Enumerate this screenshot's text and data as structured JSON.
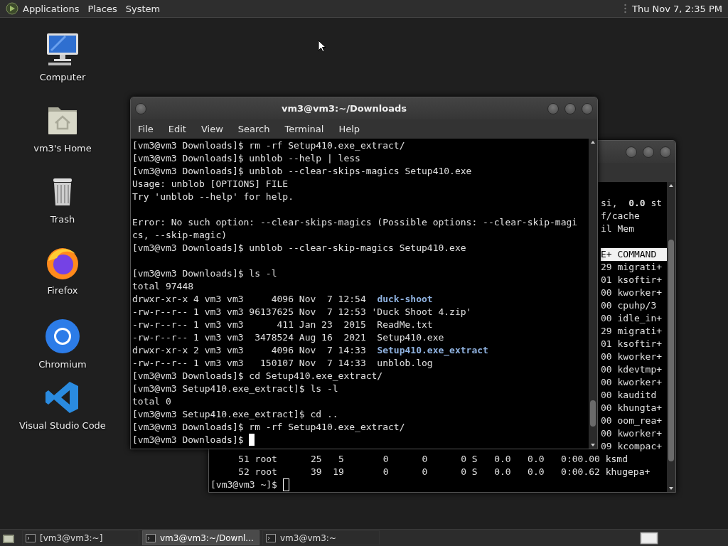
{
  "top_panel": {
    "menus": [
      "Applications",
      "Places",
      "System"
    ],
    "clock": "Thu Nov 7, 2:35 PM"
  },
  "desktop_icons": [
    {
      "label": "Computer",
      "kind": "computer"
    },
    {
      "label": "vm3's Home",
      "kind": "home"
    },
    {
      "label": "Trash",
      "kind": "trash"
    },
    {
      "label": "Firefox",
      "kind": "firefox"
    },
    {
      "label": "Chromium",
      "kind": "chromium"
    },
    {
      "label": "Visual Studio Code",
      "kind": "vscode"
    }
  ],
  "back_terminal": {
    "focused": false,
    "fragments": [
      {
        "kind": "text",
        "text": "si,  **0.0** st",
        "highlighted": false
      },
      {
        "kind": "text",
        "text": "f/cache",
        "highlighted": false
      },
      {
        "kind": "text",
        "text": "il Mem",
        "highlighted": false
      },
      {
        "kind": "blank"
      },
      {
        "kind": "text",
        "text": "E+ COMMAND",
        "highlighted": true
      },
      {
        "kind": "text",
        "text": "29 migrati+",
        "highlighted": false
      },
      {
        "kind": "text",
        "text": "01 ksoftir+",
        "highlighted": false
      },
      {
        "kind": "text",
        "text": "00 kworker+",
        "highlighted": false
      },
      {
        "kind": "text",
        "text": "00 cpuhp/3",
        "highlighted": false
      },
      {
        "kind": "text",
        "text": "00 idle_in+",
        "highlighted": false
      },
      {
        "kind": "text",
        "text": "29 migrati+",
        "highlighted": false
      },
      {
        "kind": "text",
        "text": "01 ksoftir+",
        "highlighted": false
      },
      {
        "kind": "text",
        "text": "00 kworker+",
        "highlighted": false
      },
      {
        "kind": "text",
        "text": "00 kdevtmp+",
        "highlighted": false
      },
      {
        "kind": "text",
        "text": "00 kworker+",
        "highlighted": false
      },
      {
        "kind": "text",
        "text": "00 kauditd",
        "highlighted": false
      },
      {
        "kind": "text",
        "text": "00 khungta+",
        "highlighted": false
      },
      {
        "kind": "text",
        "text": "00 oom_rea+",
        "highlighted": false
      },
      {
        "kind": "text",
        "text": "00 kworker+",
        "highlighted": false
      },
      {
        "kind": "text",
        "text": "09 kcompac+",
        "highlighted": false
      }
    ],
    "lines": [
      {
        "text": "     51 root      25   5       0      0      0 S   0.0   0.0   0:00.00 ksmd"
      },
      {
        "text": "     52 root      39  19       0      0      0 S   0.0   0.0   0:00.62 khugepa+"
      },
      {
        "text": "[vm3@vm3 ~]$ ",
        "cursor": true
      }
    ]
  },
  "front_terminal": {
    "title": "vm3@vm3:~/Downloads",
    "focused": true,
    "menu": [
      "File",
      "Edit",
      "View",
      "Search",
      "Terminal",
      "Help"
    ],
    "lines": [
      {
        "kind": "text",
        "text": "[vm3@vm3 Downloads]$ rm -rf Setup410.exe_extract/"
      },
      {
        "kind": "text",
        "text": "[vm3@vm3 Downloads]$ unblob --help | less"
      },
      {
        "kind": "text",
        "text": "[vm3@vm3 Downloads]$ unblob --clear-skips-magics Setup410.exe"
      },
      {
        "kind": "text",
        "text": "Usage: unblob [OPTIONS] FILE"
      },
      {
        "kind": "text",
        "text": "Try 'unblob --help' for help."
      },
      {
        "kind": "blank"
      },
      {
        "kind": "text",
        "text": "Error: No such option: --clear-skips-magics (Possible options: --clear-skip-magi"
      },
      {
        "kind": "text",
        "text": "cs, --skip-magic)"
      },
      {
        "kind": "text",
        "text": "[vm3@vm3 Downloads]$ unblob --clear-skip-magics Setup410.exe"
      },
      {
        "kind": "blank"
      },
      {
        "kind": "text",
        "text": "[vm3@vm3 Downloads]$ ls -l"
      },
      {
        "kind": "text",
        "text": "total 97448"
      },
      {
        "kind": "text",
        "text": "drwxr-xr-x 4 vm3 vm3     4096 Nov  7 12:54  ",
        "dir": "duck-shoot"
      },
      {
        "kind": "text",
        "text": "-rw-r--r-- 1 vm3 vm3 96137625 Nov  7 12:53 'Duck Shoot 4.zip'"
      },
      {
        "kind": "text",
        "text": "-rw-r--r-- 1 vm3 vm3      411 Jan 23  2015  ReadMe.txt"
      },
      {
        "kind": "text",
        "text": "-rw-r--r-- 1 vm3 vm3  3478524 Aug 16  2021  Setup410.exe"
      },
      {
        "kind": "text",
        "text": "drwxr-xr-x 2 vm3 vm3     4096 Nov  7 14:33  ",
        "dir": "Setup410.exe_extract"
      },
      {
        "kind": "text",
        "text": "-rw-r--r-- 1 vm3 vm3   150107 Nov  7 14:33  unblob.log"
      },
      {
        "kind": "text",
        "text": "[vm3@vm3 Downloads]$ cd Setup410.exe_extract/"
      },
      {
        "kind": "text",
        "text": "[vm3@vm3 Setup410.exe_extract]$ ls -l"
      },
      {
        "kind": "text",
        "text": "total 0"
      },
      {
        "kind": "text",
        "text": "[vm3@vm3 Setup410.exe_extract]$ cd .."
      },
      {
        "kind": "text",
        "text": "[vm3@vm3 Downloads]$ rm -rf Setup410.exe_extract/"
      },
      {
        "kind": "text",
        "text": "[vm3@vm3 Downloads]$ ",
        "cursor": true
      }
    ]
  },
  "taskbar": {
    "tasks": [
      {
        "label": "[vm3@vm3:~]",
        "selected": false
      },
      {
        "label": "vm3@vm3:~/Downl...",
        "selected": true
      },
      {
        "label": "vm3@vm3:~",
        "selected": false
      }
    ]
  }
}
